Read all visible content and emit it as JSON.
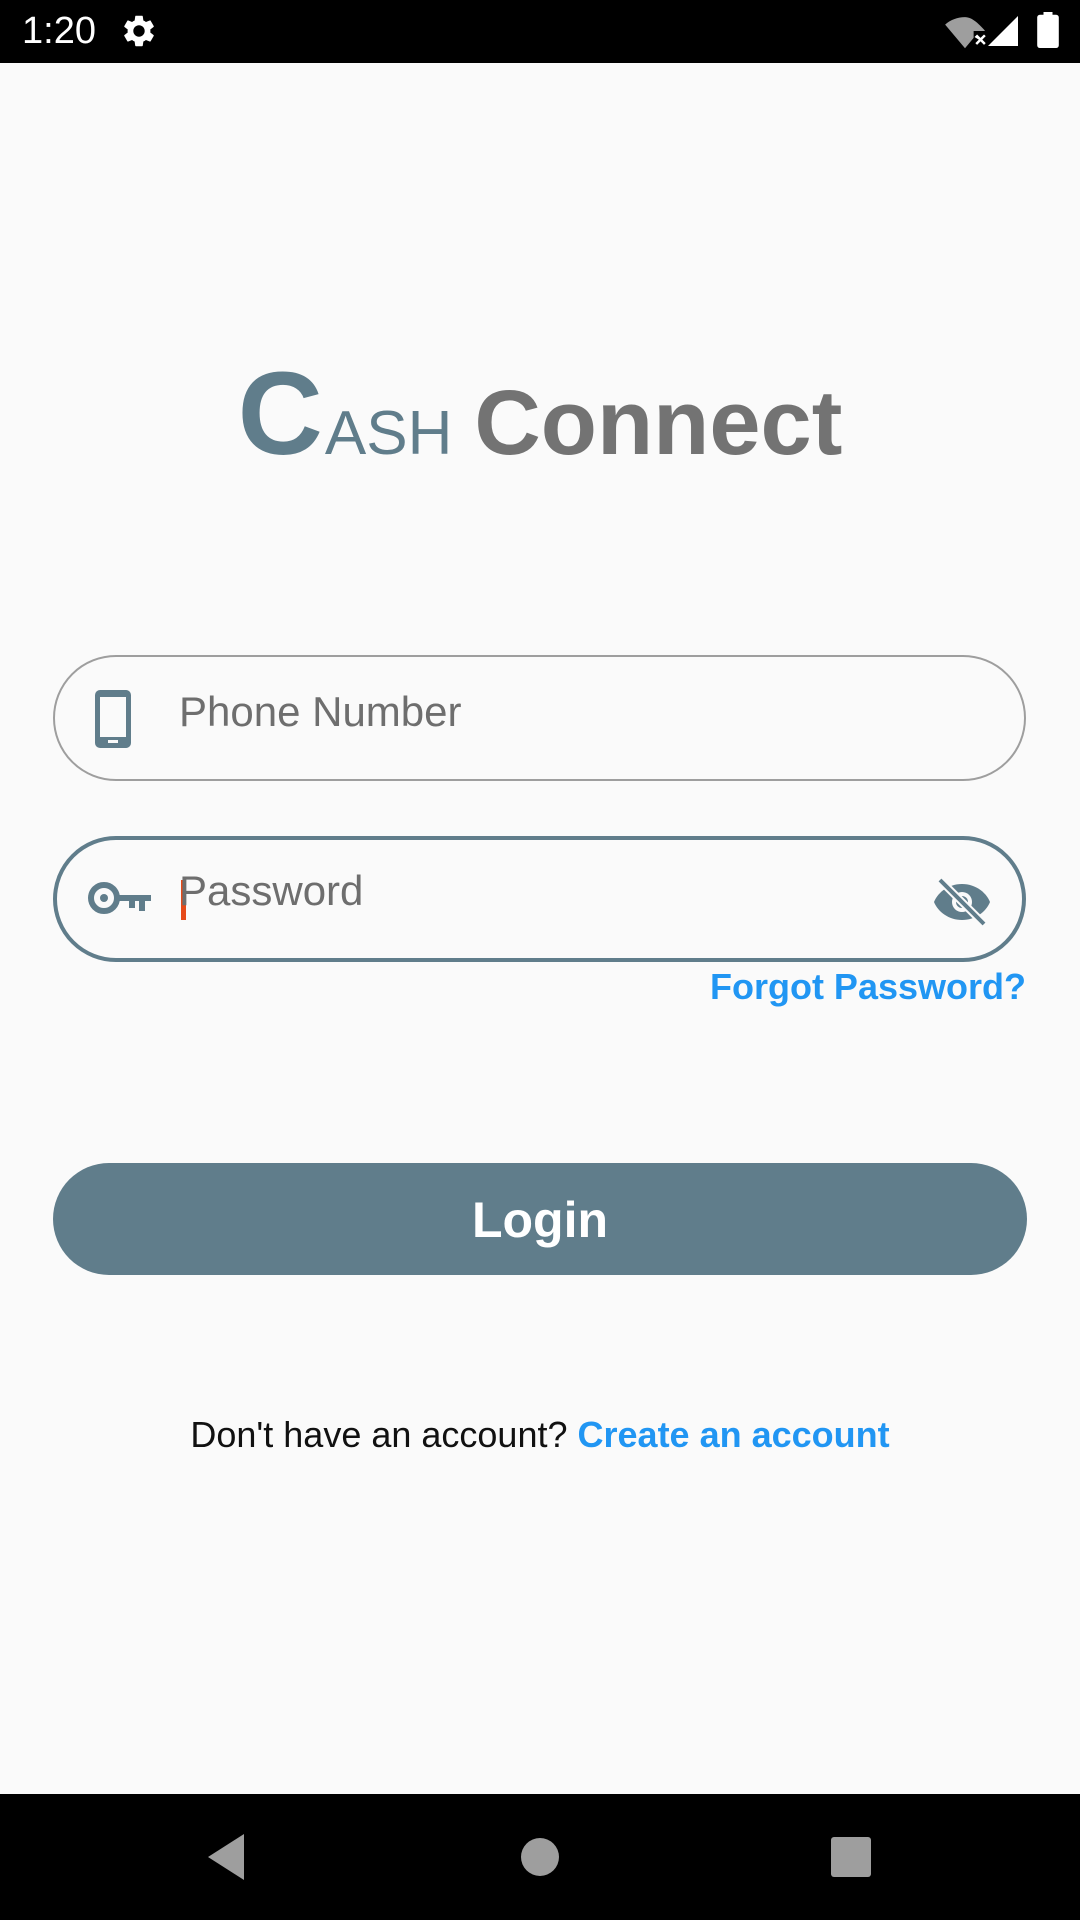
{
  "status_bar": {
    "time": "1:20",
    "icons": [
      "settings-gear-icon",
      "wifi-off-icon",
      "cell-signal-icon",
      "battery-icon"
    ]
  },
  "logo": {
    "initial": "C",
    "rest": "ASH",
    "word2": "Connect",
    "colors": {
      "primary": "#607d8b",
      "secondary": "#737373"
    }
  },
  "form": {
    "phone": {
      "placeholder": "Phone Number",
      "value": "",
      "icon": "smartphone-icon"
    },
    "password": {
      "placeholder": "Password",
      "value": "",
      "icon": "key-icon",
      "toggle_icon": "visibility-off-icon",
      "focused": true
    },
    "forgot_label": "Forgot Password?",
    "login_label": "Login"
  },
  "signup": {
    "prompt": "Don't have an account?",
    "link": "Create an account"
  },
  "colors": {
    "accent": "#607d8b",
    "link": "#2196f3",
    "cursor": "#e64a19",
    "background": "#fafafa"
  },
  "nav_bar": {
    "icons": [
      "back-icon",
      "home-icon",
      "recents-icon"
    ]
  }
}
